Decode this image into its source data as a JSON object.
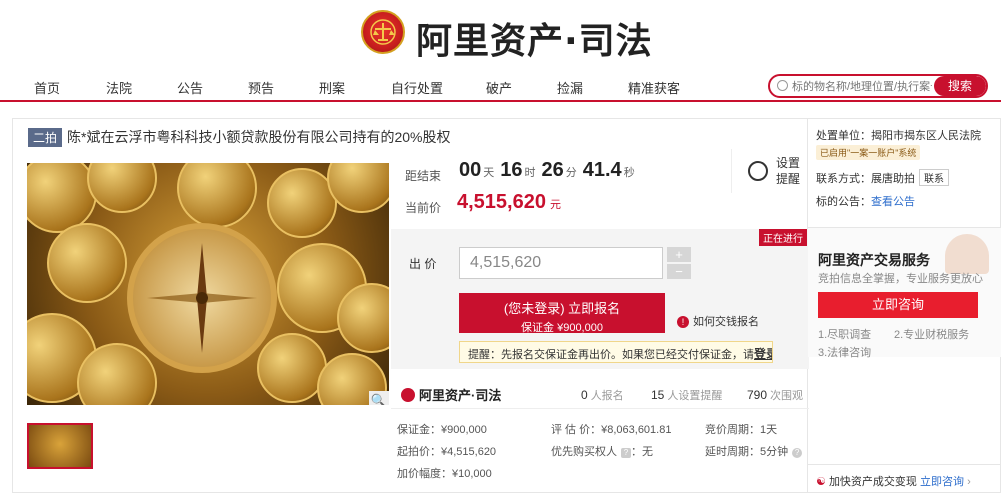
{
  "brand": {
    "title": "阿里资产·司法"
  },
  "nav": {
    "items": [
      "首页",
      "法院",
      "公告",
      "预告",
      "刑案",
      "自行处置",
      "破产",
      "捡漏",
      "精准获客"
    ]
  },
  "search": {
    "placeholder": "标的物名称/地理位置/执行案号",
    "button": "搜索"
  },
  "item": {
    "round": "二拍",
    "title": "陈*斌在云浮市粤科科技小额贷款股份有限公司持有的20%股权"
  },
  "auction": {
    "countdown_label": "距结束",
    "days": "00",
    "day_unit": "天",
    "hours": "16",
    "hour_unit": "时",
    "minutes": "26",
    "minute_unit": "分",
    "seconds": "41.4",
    "second_unit": "秒",
    "price_label": "当前价",
    "price": "4,515,620",
    "price_unit": "元",
    "remind": "设置提醒",
    "status": "正在进行",
    "bid_label": "出 价",
    "bid_value": "4,515,620",
    "register_line1": "(您未登录) 立即报名",
    "register_line2": "保证金 ¥900,000",
    "how_to": "如何交钱报名",
    "tip_text": "提醒：先报名交保证金再出价。如果您已经交付保证金，请",
    "tip_login": "登录"
  },
  "stats": {
    "brand": "阿里资产·司法",
    "registered": "0",
    "registered_label": "人报名",
    "reminders": "15",
    "reminders_label": "人设置提醒",
    "views": "790",
    "views_label": "次围观"
  },
  "details": {
    "deposit": "保证金：¥900,000",
    "appraisal": "评 估 价：¥8,063,601.81",
    "cycle": "竞价周期：1天",
    "start_price": "起拍价：¥4,515,620",
    "priority": "优先购买权人",
    "priority_value": "：无",
    "delay": "延时周期：5分钟",
    "increment": "加价幅度：¥10,000"
  },
  "side": {
    "court": "处置单位：揭阳市揭东区人民法院",
    "badge": "已启用\"一案一账户\"系统",
    "contact": "联系方式：展唐助拍",
    "contact_btn": "联系",
    "notice_label": "标的公告：",
    "notice_link": "查看公告",
    "svc_title": "阿里资产交易服务",
    "svc_sub": "竞拍信息全掌握，专业服务更放心",
    "consult": "立即咨询",
    "svc1": "1.尽职调查",
    "svc2": "2.专业财税服务",
    "svc3": "3.法律咨询",
    "foot_text": "加快资产成交变现",
    "foot_link": "立即咨询"
  },
  "colors": {
    "accent": "#c8102e",
    "tag": "#5a6a8a"
  }
}
